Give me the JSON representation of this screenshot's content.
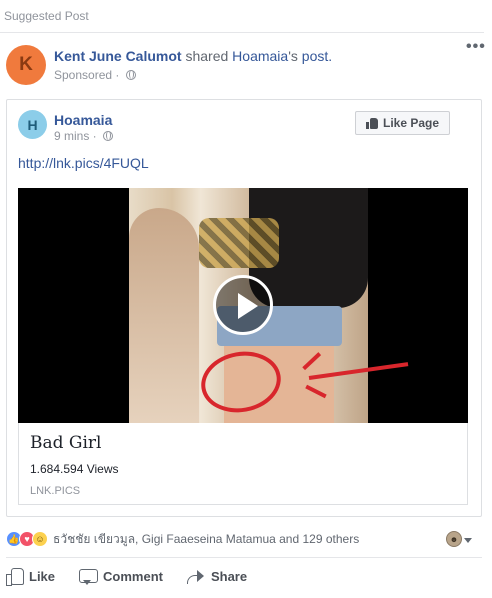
{
  "suggested_label": "Suggested Post",
  "sharer": {
    "avatar_letter": "K",
    "name": "Kent June Calumot",
    "action": "shared",
    "page_name": "Hoamaia",
    "possessive": "'s",
    "object": "post.",
    "sponsored": "Sponsored",
    "more": "•••"
  },
  "shared_post": {
    "avatar_letter": "H",
    "page_name": "Hoamaia",
    "time": "9 mins",
    "like_page_label": "Like Page",
    "url": "http://lnk.pics/4FUQL"
  },
  "link_preview": {
    "title": "Bad Girl",
    "description": "1.684.594 Views",
    "domain": "LNK.PICS"
  },
  "reactions": {
    "icons": [
      "like-icon",
      "love-icon",
      "haha-icon"
    ],
    "text": "ธวัชชัย เขียวมูล, Gigi Faaeseina Matamua and 129 others"
  },
  "actions": {
    "like": "Like",
    "comment": "Comment",
    "share": "Share"
  },
  "colors": {
    "link": "#365899",
    "like_reaction": "#5890ff",
    "love_reaction": "#f25268",
    "haha_reaction": "#fcd14f",
    "avatar_k": "#f07a3d",
    "avatar_h": "#8ccde9",
    "annotation_red": "#d8262c"
  }
}
